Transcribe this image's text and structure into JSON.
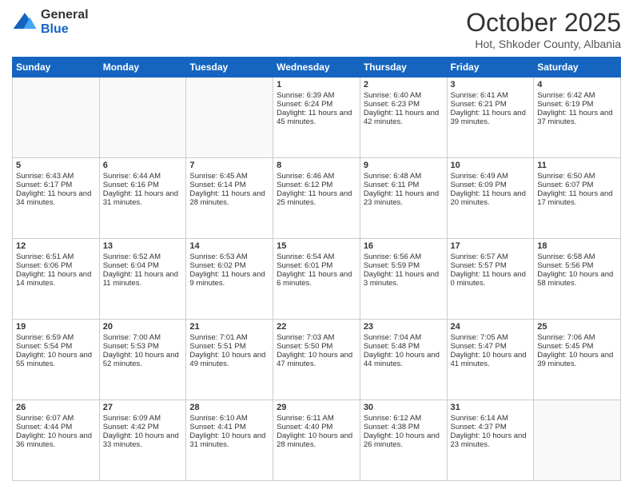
{
  "logo": {
    "general": "General",
    "blue": "Blue"
  },
  "header": {
    "month": "October 2025",
    "location": "Hot, Shkoder County, Albania"
  },
  "weekdays": [
    "Sunday",
    "Monday",
    "Tuesday",
    "Wednesday",
    "Thursday",
    "Friday",
    "Saturday"
  ],
  "weeks": [
    [
      {
        "day": "",
        "sunrise": "",
        "sunset": "",
        "daylight": "",
        "empty": true
      },
      {
        "day": "",
        "sunrise": "",
        "sunset": "",
        "daylight": "",
        "empty": true
      },
      {
        "day": "",
        "sunrise": "",
        "sunset": "",
        "daylight": "",
        "empty": true
      },
      {
        "day": "1",
        "sunrise": "Sunrise: 6:39 AM",
        "sunset": "Sunset: 6:24 PM",
        "daylight": "Daylight: 11 hours and 45 minutes.",
        "empty": false
      },
      {
        "day": "2",
        "sunrise": "Sunrise: 6:40 AM",
        "sunset": "Sunset: 6:23 PM",
        "daylight": "Daylight: 11 hours and 42 minutes.",
        "empty": false
      },
      {
        "day": "3",
        "sunrise": "Sunrise: 6:41 AM",
        "sunset": "Sunset: 6:21 PM",
        "daylight": "Daylight: 11 hours and 39 minutes.",
        "empty": false
      },
      {
        "day": "4",
        "sunrise": "Sunrise: 6:42 AM",
        "sunset": "Sunset: 6:19 PM",
        "daylight": "Daylight: 11 hours and 37 minutes.",
        "empty": false
      }
    ],
    [
      {
        "day": "5",
        "sunrise": "Sunrise: 6:43 AM",
        "sunset": "Sunset: 6:17 PM",
        "daylight": "Daylight: 11 hours and 34 minutes.",
        "empty": false
      },
      {
        "day": "6",
        "sunrise": "Sunrise: 6:44 AM",
        "sunset": "Sunset: 6:16 PM",
        "daylight": "Daylight: 11 hours and 31 minutes.",
        "empty": false
      },
      {
        "day": "7",
        "sunrise": "Sunrise: 6:45 AM",
        "sunset": "Sunset: 6:14 PM",
        "daylight": "Daylight: 11 hours and 28 minutes.",
        "empty": false
      },
      {
        "day": "8",
        "sunrise": "Sunrise: 6:46 AM",
        "sunset": "Sunset: 6:12 PM",
        "daylight": "Daylight: 11 hours and 25 minutes.",
        "empty": false
      },
      {
        "day": "9",
        "sunrise": "Sunrise: 6:48 AM",
        "sunset": "Sunset: 6:11 PM",
        "daylight": "Daylight: 11 hours and 23 minutes.",
        "empty": false
      },
      {
        "day": "10",
        "sunrise": "Sunrise: 6:49 AM",
        "sunset": "Sunset: 6:09 PM",
        "daylight": "Daylight: 11 hours and 20 minutes.",
        "empty": false
      },
      {
        "day": "11",
        "sunrise": "Sunrise: 6:50 AM",
        "sunset": "Sunset: 6:07 PM",
        "daylight": "Daylight: 11 hours and 17 minutes.",
        "empty": false
      }
    ],
    [
      {
        "day": "12",
        "sunrise": "Sunrise: 6:51 AM",
        "sunset": "Sunset: 6:06 PM",
        "daylight": "Daylight: 11 hours and 14 minutes.",
        "empty": false
      },
      {
        "day": "13",
        "sunrise": "Sunrise: 6:52 AM",
        "sunset": "Sunset: 6:04 PM",
        "daylight": "Daylight: 11 hours and 11 minutes.",
        "empty": false
      },
      {
        "day": "14",
        "sunrise": "Sunrise: 6:53 AM",
        "sunset": "Sunset: 6:02 PM",
        "daylight": "Daylight: 11 hours and 9 minutes.",
        "empty": false
      },
      {
        "day": "15",
        "sunrise": "Sunrise: 6:54 AM",
        "sunset": "Sunset: 6:01 PM",
        "daylight": "Daylight: 11 hours and 6 minutes.",
        "empty": false
      },
      {
        "day": "16",
        "sunrise": "Sunrise: 6:56 AM",
        "sunset": "Sunset: 5:59 PM",
        "daylight": "Daylight: 11 hours and 3 minutes.",
        "empty": false
      },
      {
        "day": "17",
        "sunrise": "Sunrise: 6:57 AM",
        "sunset": "Sunset: 5:57 PM",
        "daylight": "Daylight: 11 hours and 0 minutes.",
        "empty": false
      },
      {
        "day": "18",
        "sunrise": "Sunrise: 6:58 AM",
        "sunset": "Sunset: 5:56 PM",
        "daylight": "Daylight: 10 hours and 58 minutes.",
        "empty": false
      }
    ],
    [
      {
        "day": "19",
        "sunrise": "Sunrise: 6:59 AM",
        "sunset": "Sunset: 5:54 PM",
        "daylight": "Daylight: 10 hours and 55 minutes.",
        "empty": false
      },
      {
        "day": "20",
        "sunrise": "Sunrise: 7:00 AM",
        "sunset": "Sunset: 5:53 PM",
        "daylight": "Daylight: 10 hours and 52 minutes.",
        "empty": false
      },
      {
        "day": "21",
        "sunrise": "Sunrise: 7:01 AM",
        "sunset": "Sunset: 5:51 PM",
        "daylight": "Daylight: 10 hours and 49 minutes.",
        "empty": false
      },
      {
        "day": "22",
        "sunrise": "Sunrise: 7:03 AM",
        "sunset": "Sunset: 5:50 PM",
        "daylight": "Daylight: 10 hours and 47 minutes.",
        "empty": false
      },
      {
        "day": "23",
        "sunrise": "Sunrise: 7:04 AM",
        "sunset": "Sunset: 5:48 PM",
        "daylight": "Daylight: 10 hours and 44 minutes.",
        "empty": false
      },
      {
        "day": "24",
        "sunrise": "Sunrise: 7:05 AM",
        "sunset": "Sunset: 5:47 PM",
        "daylight": "Daylight: 10 hours and 41 minutes.",
        "empty": false
      },
      {
        "day": "25",
        "sunrise": "Sunrise: 7:06 AM",
        "sunset": "Sunset: 5:45 PM",
        "daylight": "Daylight: 10 hours and 39 minutes.",
        "empty": false
      }
    ],
    [
      {
        "day": "26",
        "sunrise": "Sunrise: 6:07 AM",
        "sunset": "Sunset: 4:44 PM",
        "daylight": "Daylight: 10 hours and 36 minutes.",
        "empty": false
      },
      {
        "day": "27",
        "sunrise": "Sunrise: 6:09 AM",
        "sunset": "Sunset: 4:42 PM",
        "daylight": "Daylight: 10 hours and 33 minutes.",
        "empty": false
      },
      {
        "day": "28",
        "sunrise": "Sunrise: 6:10 AM",
        "sunset": "Sunset: 4:41 PM",
        "daylight": "Daylight: 10 hours and 31 minutes.",
        "empty": false
      },
      {
        "day": "29",
        "sunrise": "Sunrise: 6:11 AM",
        "sunset": "Sunset: 4:40 PM",
        "daylight": "Daylight: 10 hours and 28 minutes.",
        "empty": false
      },
      {
        "day": "30",
        "sunrise": "Sunrise: 6:12 AM",
        "sunset": "Sunset: 4:38 PM",
        "daylight": "Daylight: 10 hours and 26 minutes.",
        "empty": false
      },
      {
        "day": "31",
        "sunrise": "Sunrise: 6:14 AM",
        "sunset": "Sunset: 4:37 PM",
        "daylight": "Daylight: 10 hours and 23 minutes.",
        "empty": false
      },
      {
        "day": "",
        "sunrise": "",
        "sunset": "",
        "daylight": "",
        "empty": true
      }
    ]
  ]
}
